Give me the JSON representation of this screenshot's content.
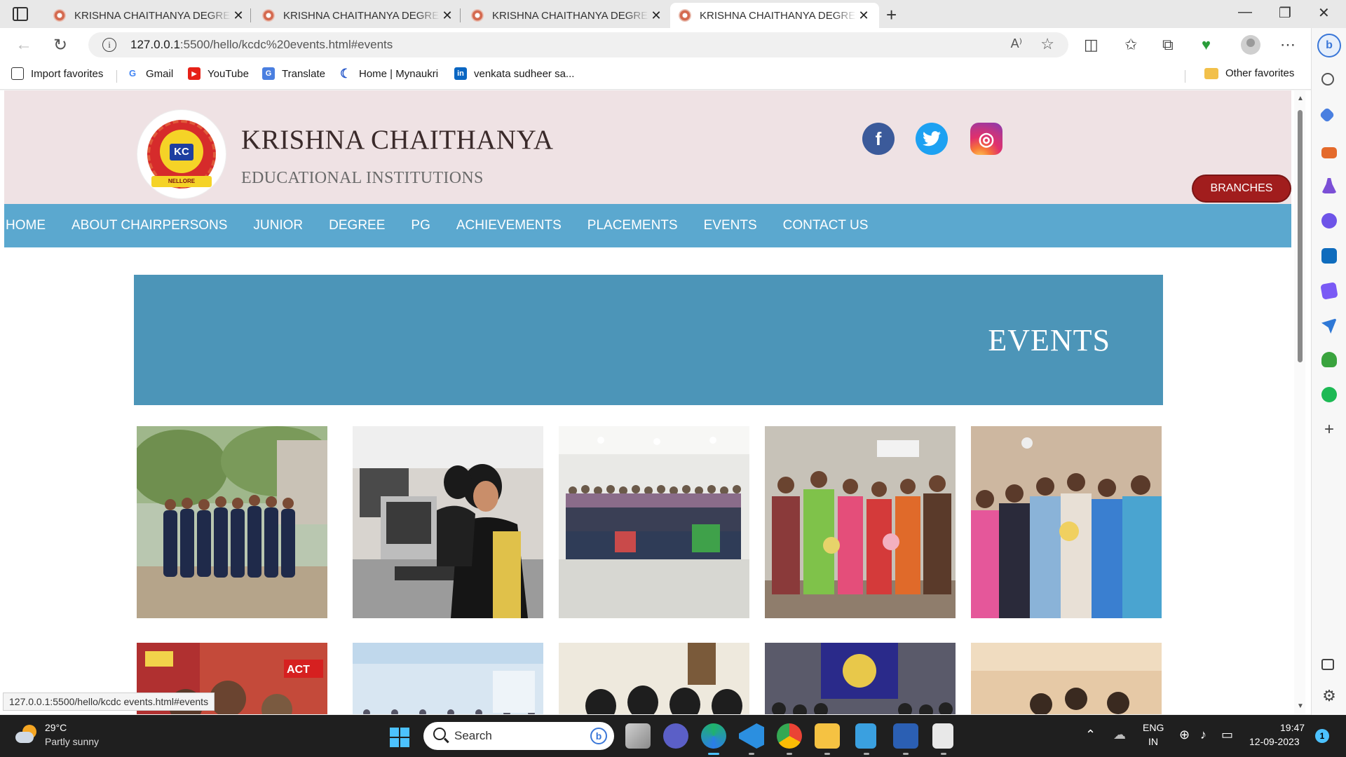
{
  "browser": {
    "tabs": [
      {
        "title": "KRISHNA CHAITHANYA DEGREE"
      },
      {
        "title": "KRISHNA CHAITHANYA DEGREE"
      },
      {
        "title": "KRISHNA CHAITHANYA DEGREE"
      },
      {
        "title": "KRISHNA CHAITHANYA DEGREE"
      }
    ],
    "url_host": "127.0.0.1",
    "url_path": ":5500/hello/kcdc%20events.html#events",
    "favorites": [
      {
        "label": "Import favorites",
        "icon": "import-icon"
      },
      {
        "label": "Gmail",
        "icon": "google-icon"
      },
      {
        "label": "YouTube",
        "icon": "youtube-icon"
      },
      {
        "label": "Translate",
        "icon": "translate-icon"
      },
      {
        "label": "Home | Mynaukri",
        "icon": "mynaukri-icon"
      },
      {
        "label": "venkata sudheer sa...",
        "icon": "linkedin-icon"
      }
    ],
    "other_favorites": "Other favorites",
    "status_url": "127.0.0.1:5500/hello/kcdc events.html#events"
  },
  "site": {
    "title": "KRISHNA CHAITHANYA",
    "subtitle": "EDUCATIONAL INSTITUTIONS",
    "logo_text": "KC",
    "logo_ribbon": "NELLORE",
    "branches_label": "BRANCHES",
    "nav": [
      "HOME",
      "ABOUT CHAIRPERSONS",
      "JUNIOR",
      "DEGREE",
      "PG",
      "ACHIEVEMENTS",
      "PLACEMENTS",
      "EVENTS",
      "CONTACT US"
    ],
    "banner_heading": "EVENTS",
    "social": {
      "facebook": "f",
      "twitter": "t",
      "instagram": "◎"
    },
    "colors": {
      "header_bg": "#efe2e4",
      "nav_bg": "#5ba8cf",
      "banner_bg": "#4c95b8",
      "branches_bg": "#a11d1d"
    }
  },
  "taskbar": {
    "temp": "29°C",
    "weather": "Partly sunny",
    "search_label": "Search",
    "lang_line1": "ENG",
    "lang_line2": "IN",
    "time": "19:47",
    "date": "12-09-2023",
    "notification_count": "1"
  }
}
